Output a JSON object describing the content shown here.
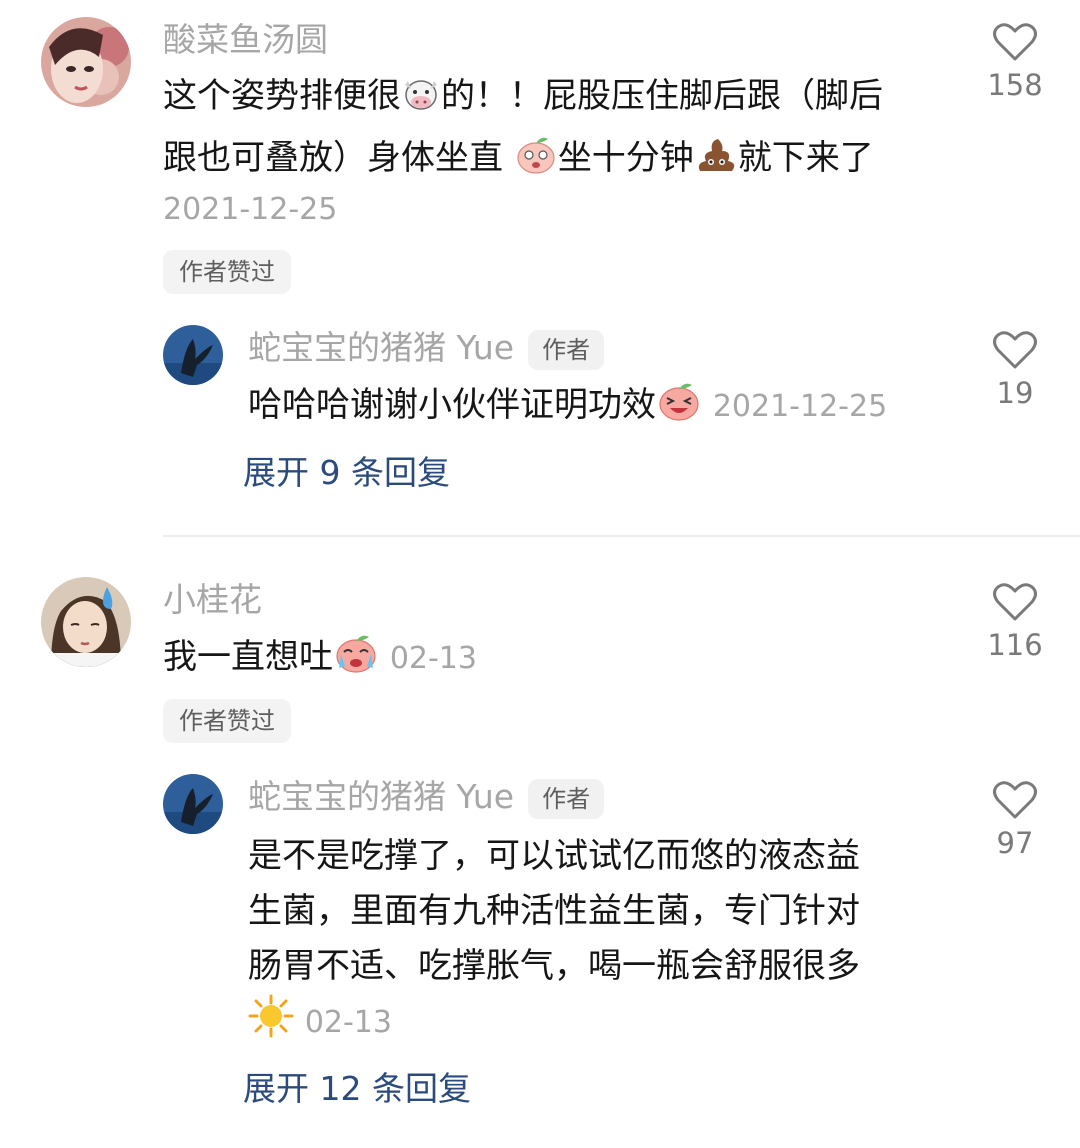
{
  "comments": [
    {
      "username": "酸菜鱼汤圆",
      "text_line1_a": "这个姿势排便很",
      "text_line1_b": "的！！屁股压住脚后跟（脚后",
      "text_line2_a": "跟也可叠放）身体坐直 ",
      "text_line2_b": "坐十分钟",
      "text_line2_c": "就下来了",
      "date": "2021-12-25",
      "liked_badge": "作者赞过",
      "likes": "158",
      "reply": {
        "username": "蛇宝宝的猪猪 Yue",
        "author_tag": "作者",
        "text": "哈哈哈谢谢小伙伴证明功效",
        "date": "2021-12-25",
        "likes": "19"
      },
      "expand_label": "展开 9 条回复"
    },
    {
      "username": "小桂花",
      "text": "我一直想吐",
      "date": "02-13",
      "liked_badge": "作者赞过",
      "likes": "116",
      "reply": {
        "username": "蛇宝宝的猪猪 Yue",
        "author_tag": "作者",
        "text_line1": "是不是吃撑了，可以试试亿而悠的液态益",
        "text_line2": "生菌，里面有九种活性益生菌，专门针对",
        "text_line3": "肠胃不适、吃撑胀气，喝一瓶会舒服很多",
        "date": "02-13",
        "likes": "97"
      },
      "expand_label": "展开 12 条回复"
    }
  ],
  "icons": {
    "like": "heart-outline-icon",
    "cow": "cow-face-emoji",
    "peach_blush": "peach-blush-emoji",
    "poop": "poop-emoji",
    "peach_laugh": "peach-laugh-emoji",
    "peach_cry": "peach-cry-emoji",
    "sun": "sun-emoji"
  },
  "colors": {
    "link": "#2a4b7c",
    "muted": "#a6a6a6",
    "text": "#161616"
  }
}
